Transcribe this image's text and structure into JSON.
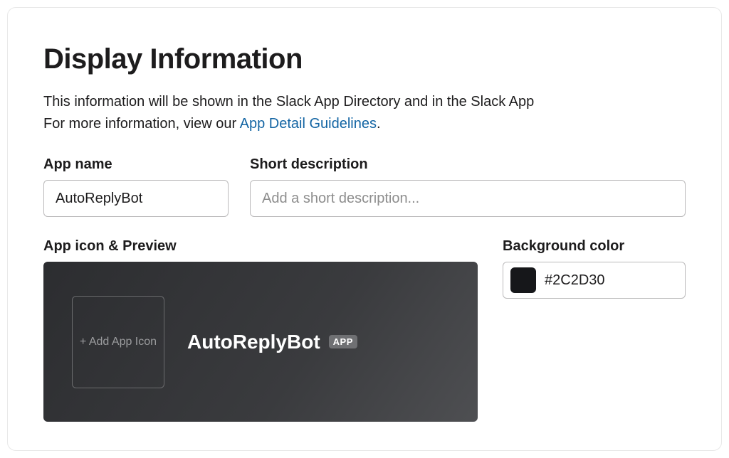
{
  "section": {
    "heading": "Display Information",
    "description_line1": "This information will be shown in the Slack App Directory and in the Slack App",
    "description_line2_prefix": "For more information, view our ",
    "guidelines_link_text": "App Detail Guidelines",
    "description_line2_suffix": "."
  },
  "fields": {
    "app_name": {
      "label": "App name",
      "value": "AutoReplyBot"
    },
    "short_description": {
      "label": "Short description",
      "placeholder": "Add a short description..."
    },
    "icon_preview": {
      "label": "App icon & Preview",
      "add_icon_text": "+ Add App Icon",
      "preview_name": "AutoReplyBot",
      "badge": "APP"
    },
    "background_color": {
      "label": "Background color",
      "value": "#2C2D30",
      "swatch_color": "#16171a"
    }
  }
}
